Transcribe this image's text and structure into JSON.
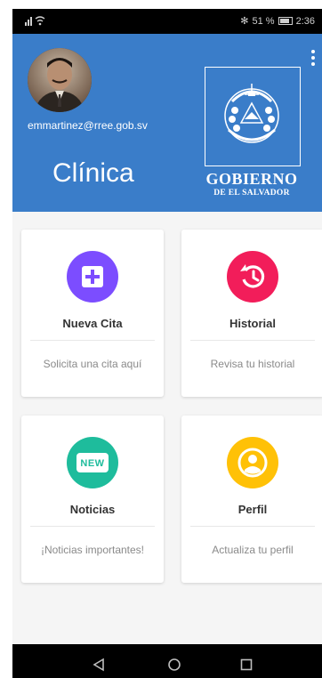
{
  "status_bar": {
    "signal_icon": "signal-wifi-icon",
    "right_text": "51 % ",
    "time": "2:36"
  },
  "header": {
    "email": "emmartinez@rree.gob.sv",
    "title": "Clínica",
    "logo": {
      "line1": "GOBIERNO",
      "line2": "DE EL SALVADOR"
    }
  },
  "cards": [
    {
      "title": "Nueva Cita",
      "description": "Solicita una cita aquí",
      "icon": "add-box-icon",
      "color": "#7c4dff"
    },
    {
      "title": "Historial",
      "description": "Revisa tu historial",
      "icon": "history-icon",
      "color": "#f21d5a"
    },
    {
      "title": "Noticias",
      "description": "¡Noticias importantes!",
      "icon": "new-badge-icon",
      "color": "#1ebc9c",
      "icon_text": "NEW"
    },
    {
      "title": "Perfil",
      "description": "Actualiza tu perfil",
      "icon": "account-circle-icon",
      "color": "#ffc107"
    }
  ],
  "colors": {
    "header": "#3a7dc9",
    "background": "#f5f5f5"
  }
}
